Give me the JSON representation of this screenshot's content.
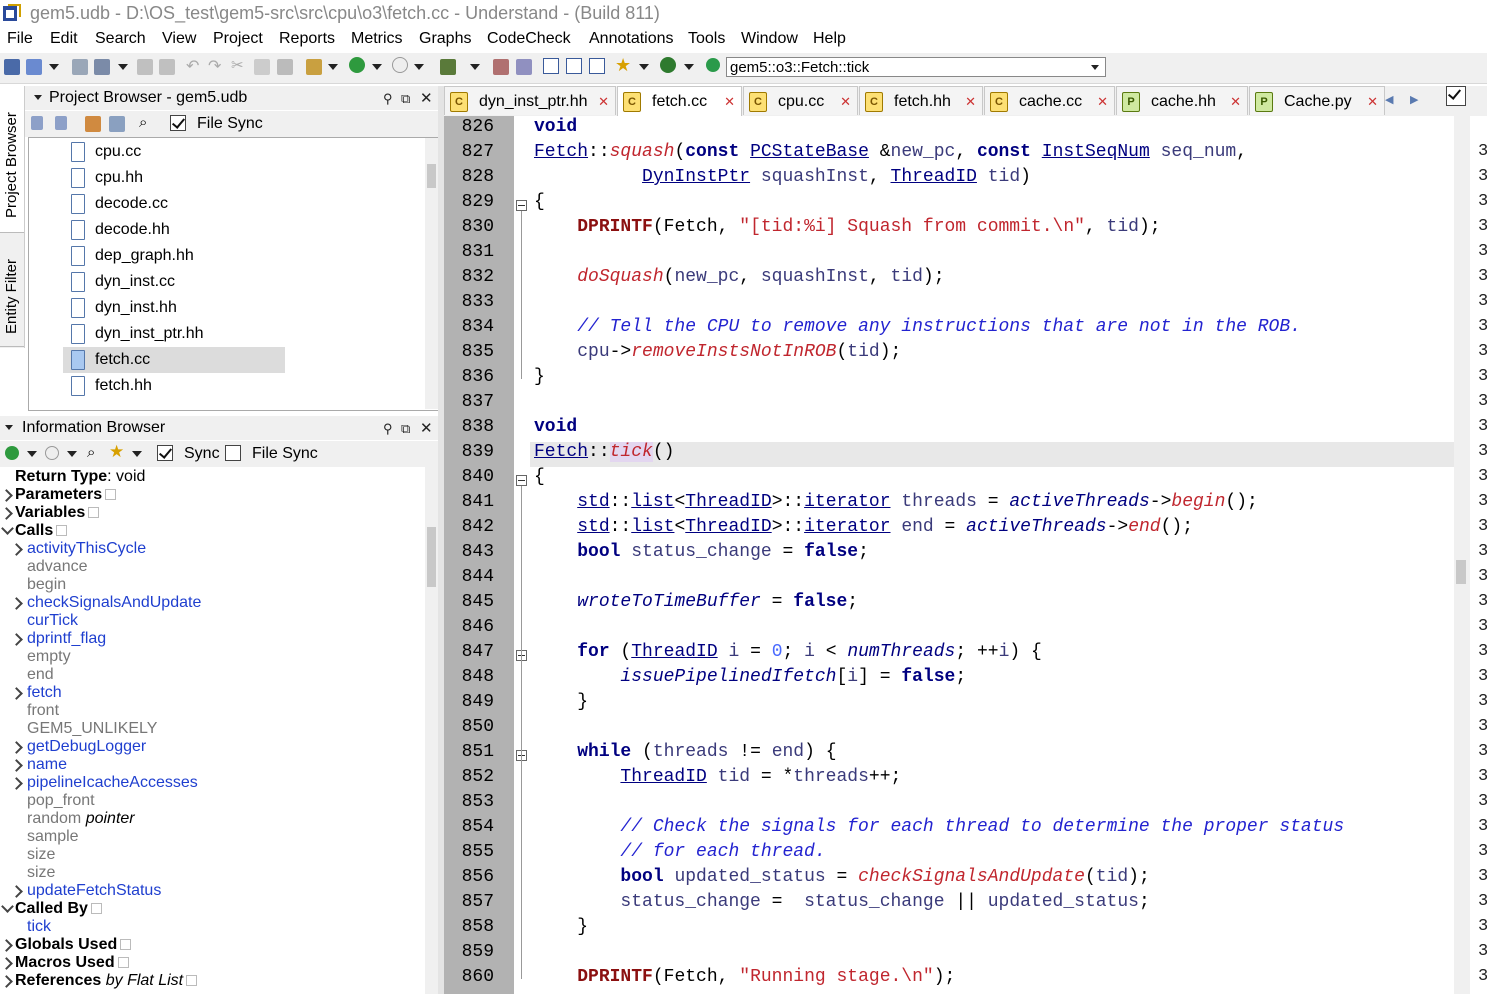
{
  "window": {
    "title": "gem5.udb - D:\\OS_test\\gem5-src\\src\\cpu\\o3\\fetch.cc - Understand - (Build 811)"
  },
  "menu": [
    "File",
    "Edit",
    "Search",
    "View",
    "Project",
    "Reports",
    "Metrics",
    "Graphs",
    "CodeCheck",
    "Annotations",
    "Tools",
    "Window",
    "Help"
  ],
  "toolbar": {
    "scope_value": "gem5::o3::Fetch::tick"
  },
  "side_tabs": {
    "project_browser": "Project Browser",
    "entity_filter": "Entity Filter"
  },
  "project_browser": {
    "title": "Project Browser - gem5.udb",
    "file_sync_label": "File Sync",
    "files": [
      "cpu.cc",
      "cpu.hh",
      "decode.cc",
      "decode.hh",
      "dep_graph.hh",
      "dyn_inst.cc",
      "dyn_inst.hh",
      "dyn_inst_ptr.hh",
      "fetch.cc",
      "fetch.hh"
    ],
    "selected": "fetch.cc"
  },
  "info_browser": {
    "title": "Information Browser",
    "sync_label": "Sync",
    "file_sync_label": "File Sync",
    "return_type_label": "Return Type",
    "return_type_value": ": void",
    "sections": {
      "parameters": "Parameters",
      "variables": "Variables",
      "calls": "Calls",
      "called_by": "Called By",
      "globals_used": "Globals Used",
      "macros_used": "Macros Used",
      "references": "References",
      "references_suffix": " by Flat List"
    },
    "calls": [
      {
        "name": "activityThisCycle",
        "link": true,
        "expand": true
      },
      {
        "name": "advance",
        "link": false,
        "expand": false
      },
      {
        "name": "begin",
        "link": false,
        "expand": false
      },
      {
        "name": "checkSignalsAndUpdate",
        "link": true,
        "expand": true
      },
      {
        "name": "curTick",
        "link": true,
        "expand": false
      },
      {
        "name": "dprintf_flag",
        "link": true,
        "expand": true
      },
      {
        "name": "empty",
        "link": false,
        "expand": false
      },
      {
        "name": "end",
        "link": false,
        "expand": false
      },
      {
        "name": "fetch",
        "link": true,
        "expand": true
      },
      {
        "name": "front",
        "link": false,
        "expand": false
      },
      {
        "name": "GEM5_UNLIKELY",
        "link": false,
        "expand": false
      },
      {
        "name": "getDebugLogger",
        "link": true,
        "expand": true
      },
      {
        "name": "name",
        "link": true,
        "expand": true
      },
      {
        "name": "pipelineIcacheAccesses",
        "link": true,
        "expand": true
      },
      {
        "name": "pop_front",
        "link": false,
        "expand": false
      },
      {
        "name": "random",
        "link": false,
        "expand": false,
        "extra": "pointer"
      },
      {
        "name": "sample",
        "link": false,
        "expand": false
      },
      {
        "name": "size",
        "link": false,
        "expand": false
      },
      {
        "name": "size",
        "link": false,
        "expand": false
      },
      {
        "name": "updateFetchStatus",
        "link": true,
        "expand": true
      }
    ],
    "called_by": [
      "tick"
    ]
  },
  "editor_tabs": [
    {
      "label": "dyn_inst_ptr.hh",
      "kind": "c",
      "active": false
    },
    {
      "label": "fetch.cc",
      "kind": "c",
      "active": true
    },
    {
      "label": "cpu.cc",
      "kind": "c",
      "active": false
    },
    {
      "label": "fetch.hh",
      "kind": "c",
      "active": false
    },
    {
      "label": "cache.cc",
      "kind": "c",
      "active": false
    },
    {
      "label": "cache.hh",
      "kind": "py",
      "active": false
    },
    {
      "label": "Cache.py",
      "kind": "py",
      "active": false
    }
  ],
  "code": {
    "first_line": 826,
    "highlight_line": 839,
    "lines": [
      [
        [
          "kw",
          "void"
        ]
      ],
      [
        [
          "ty",
          "Fetch"
        ],
        [
          "",
          "::"
        ],
        [
          "fn",
          "squash"
        ],
        [
          "",
          "("
        ],
        [
          "kw",
          "const"
        ],
        [
          "",
          " "
        ],
        [
          "ty",
          "PCStateBase"
        ],
        [
          "",
          " &"
        ],
        [
          "nm",
          "new_pc"
        ],
        [
          "",
          ", "
        ],
        [
          "kw",
          "const"
        ],
        [
          "",
          " "
        ],
        [
          "ty",
          "InstSeqNum"
        ],
        [
          "",
          " "
        ],
        [
          "nm",
          "seq_num"
        ],
        [
          "",
          ","
        ]
      ],
      [
        [
          "",
          "          "
        ],
        [
          "ty",
          "DynInstPtr"
        ],
        [
          "",
          " "
        ],
        [
          "nm",
          "squashInst"
        ],
        [
          "",
          ", "
        ],
        [
          "ty",
          "ThreadID"
        ],
        [
          "",
          " "
        ],
        [
          "nm",
          "tid"
        ],
        [
          "",
          ")"
        ]
      ],
      [
        [
          "",
          "{"
        ]
      ],
      [
        [
          "",
          "    "
        ],
        [
          "dp",
          "DPRINTF"
        ],
        [
          "",
          "(Fetch, "
        ],
        [
          "str",
          "\"[tid:%i] Squash from commit.\\n\""
        ],
        [
          "",
          ", "
        ],
        [
          "nm",
          "tid"
        ],
        [
          "",
          ");"
        ]
      ],
      [],
      [
        [
          "",
          "    "
        ],
        [
          "fn",
          "doSquash"
        ],
        [
          "",
          "("
        ],
        [
          "nm",
          "new_pc"
        ],
        [
          "",
          ", "
        ],
        [
          "nm",
          "squashInst"
        ],
        [
          "",
          ", "
        ],
        [
          "nm",
          "tid"
        ],
        [
          "",
          ");"
        ]
      ],
      [],
      [
        [
          "",
          "    "
        ],
        [
          "cm",
          "// Tell the CPU to remove any instructions that are not in the ROB."
        ]
      ],
      [
        [
          "",
          "    "
        ],
        [
          "nm",
          "cpu"
        ],
        [
          "",
          "->"
        ],
        [
          "fn",
          "removeInstsNotInROB"
        ],
        [
          "",
          "("
        ],
        [
          "nm",
          "tid"
        ],
        [
          "",
          ");"
        ]
      ],
      [
        [
          "",
          "}"
        ]
      ],
      [],
      [
        [
          "kw",
          "void"
        ]
      ],
      [
        [
          "ty",
          "Fetch"
        ],
        [
          "",
          "::"
        ],
        [
          "tick",
          "tick"
        ],
        [
          "",
          "()"
        ]
      ],
      [
        [
          "",
          "{"
        ]
      ],
      [
        [
          "",
          "    "
        ],
        [
          "ty",
          "std"
        ],
        [
          "",
          "::"
        ],
        [
          "ty",
          "list"
        ],
        [
          "",
          "<"
        ],
        [
          "ty",
          "ThreadID"
        ],
        [
          "",
          ">::"
        ],
        [
          "ty",
          "iterator"
        ],
        [
          "",
          " "
        ],
        [
          "nm",
          "threads"
        ],
        [
          "",
          " = "
        ],
        [
          "gv",
          "activeThreads"
        ],
        [
          "",
          "->"
        ],
        [
          "fn",
          "begin"
        ],
        [
          "",
          "();"
        ]
      ],
      [
        [
          "",
          "    "
        ],
        [
          "ty",
          "std"
        ],
        [
          "",
          "::"
        ],
        [
          "ty",
          "list"
        ],
        [
          "",
          "<"
        ],
        [
          "ty",
          "ThreadID"
        ],
        [
          "",
          ">::"
        ],
        [
          "ty",
          "iterator"
        ],
        [
          "",
          " "
        ],
        [
          "nm",
          "end"
        ],
        [
          "",
          " = "
        ],
        [
          "gv",
          "activeThreads"
        ],
        [
          "",
          "->"
        ],
        [
          "fn",
          "end"
        ],
        [
          "",
          "();"
        ]
      ],
      [
        [
          "",
          "    "
        ],
        [
          "kw",
          "bool"
        ],
        [
          "",
          " "
        ],
        [
          "nm",
          "status_change"
        ],
        [
          "",
          " = "
        ],
        [
          "kw",
          "false"
        ],
        [
          "",
          ";"
        ]
      ],
      [],
      [
        [
          "",
          "    "
        ],
        [
          "gv",
          "wroteToTimeBuffer"
        ],
        [
          "",
          " = "
        ],
        [
          "kw",
          "false"
        ],
        [
          "",
          ";"
        ]
      ],
      [],
      [
        [
          "",
          "    "
        ],
        [
          "kw",
          "for"
        ],
        [
          "",
          " ("
        ],
        [
          "ty",
          "ThreadID"
        ],
        [
          "",
          " "
        ],
        [
          "nm",
          "i"
        ],
        [
          "",
          " = "
        ],
        [
          "num",
          "0"
        ],
        [
          "",
          "; "
        ],
        [
          "nm",
          "i"
        ],
        [
          "",
          " < "
        ],
        [
          "gv",
          "numThreads"
        ],
        [
          "",
          "; ++"
        ],
        [
          "nm",
          "i"
        ],
        [
          "",
          ") {"
        ]
      ],
      [
        [
          "",
          "        "
        ],
        [
          "gv",
          "issuePipelinedIfetch"
        ],
        [
          "",
          "["
        ],
        [
          "nm",
          "i"
        ],
        [
          "",
          "] = "
        ],
        [
          "kw",
          "false"
        ],
        [
          "",
          ";"
        ]
      ],
      [
        [
          "",
          "    }"
        ]
      ],
      [],
      [
        [
          "",
          "    "
        ],
        [
          "kw",
          "while"
        ],
        [
          "",
          " ("
        ],
        [
          "nm",
          "threads"
        ],
        [
          "",
          " != "
        ],
        [
          "nm",
          "end"
        ],
        [
          "",
          ") {"
        ]
      ],
      [
        [
          "",
          "        "
        ],
        [
          "ty",
          "ThreadID"
        ],
        [
          "",
          " "
        ],
        [
          "nm",
          "tid"
        ],
        [
          "",
          " = *"
        ],
        [
          "nm",
          "threads"
        ],
        [
          "",
          "++;"
        ]
      ],
      [],
      [
        [
          "",
          "        "
        ],
        [
          "cm",
          "// Check the signals for each thread to determine the proper status"
        ]
      ],
      [
        [
          "",
          "        "
        ],
        [
          "cm",
          "// for each thread."
        ]
      ],
      [
        [
          "",
          "        "
        ],
        [
          "kw",
          "bool"
        ],
        [
          "",
          " "
        ],
        [
          "nm",
          "updated_status"
        ],
        [
          "",
          " = "
        ],
        [
          "fn",
          "checkSignalsAndUpdate"
        ],
        [
          "",
          "("
        ],
        [
          "nm",
          "tid"
        ],
        [
          "",
          ");"
        ]
      ],
      [
        [
          "",
          "        "
        ],
        [
          "nm",
          "status_change"
        ],
        [
          "",
          " =  "
        ],
        [
          "nm",
          "status_change"
        ],
        [
          "",
          " || "
        ],
        [
          "nm",
          "updated_status"
        ],
        [
          "",
          ";"
        ]
      ],
      [
        [
          "",
          "    }"
        ]
      ],
      [],
      [
        [
          "",
          "    "
        ],
        [
          "dp",
          "DPRINTF"
        ],
        [
          "",
          "(Fetch, "
        ],
        [
          "str",
          "\"Running stage.\\n\""
        ],
        [
          "",
          ");"
        ]
      ]
    ],
    "fold_lines": [
      829,
      840,
      847,
      851
    ]
  },
  "right_marks": "3"
}
